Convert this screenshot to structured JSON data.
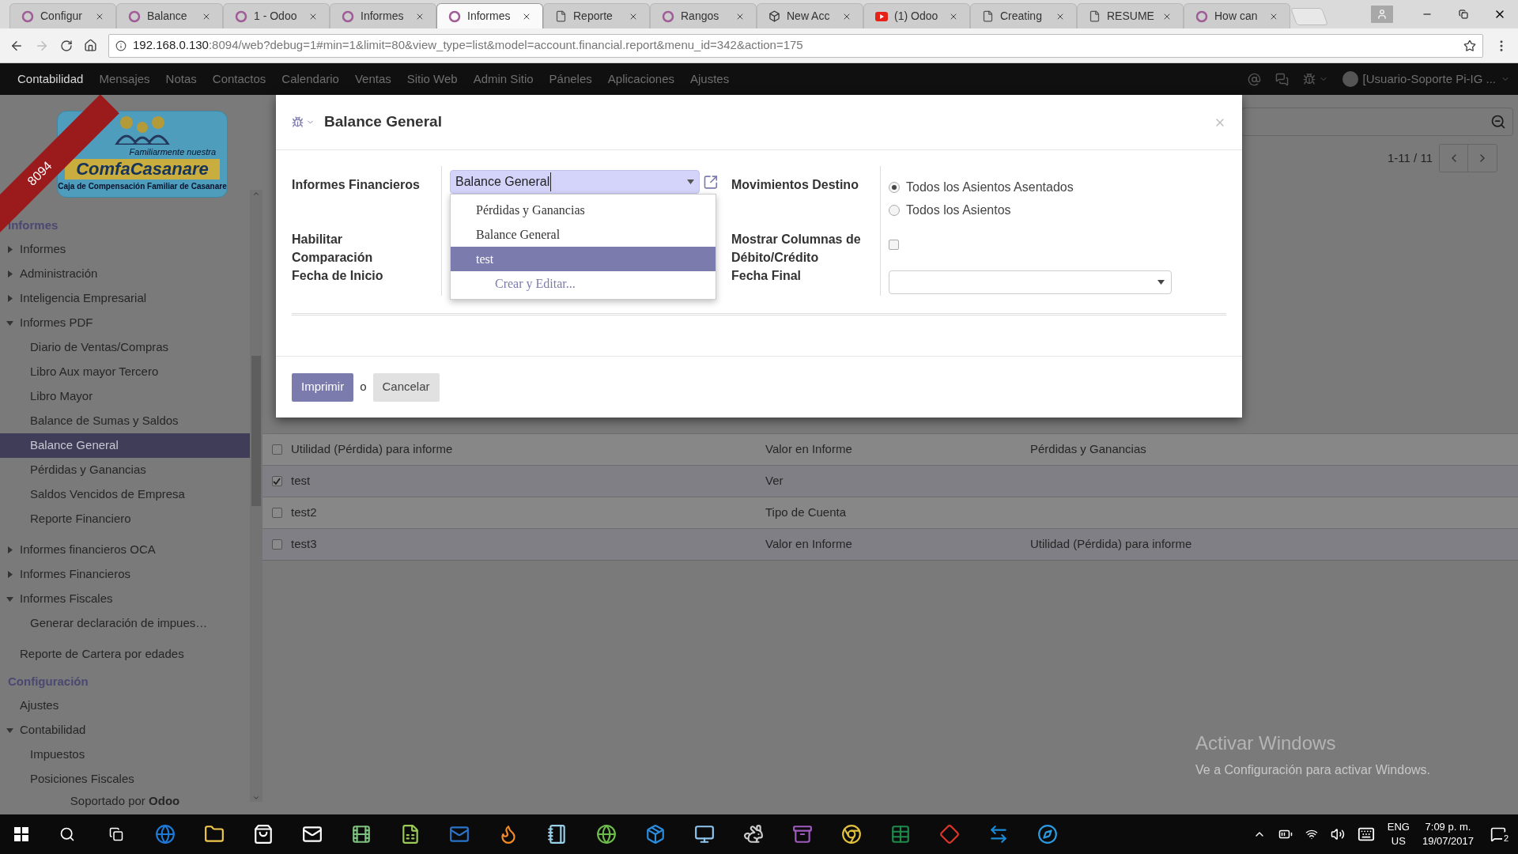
{
  "browser": {
    "tabs": [
      {
        "title": "Configur",
        "kind": "ring",
        "selected": false
      },
      {
        "title": "Balance",
        "kind": "ring",
        "selected": false
      },
      {
        "title": "1 - Odoo",
        "kind": "ring",
        "selected": false
      },
      {
        "title": "Informes",
        "kind": "ring",
        "selected": false
      },
      {
        "title": "Informes",
        "kind": "ring",
        "selected": true
      },
      {
        "title": "Reporte",
        "kind": "page",
        "selected": false
      },
      {
        "title": "Rangos",
        "kind": "ring",
        "selected": false
      },
      {
        "title": "New Acc",
        "kind": "cube",
        "selected": false
      },
      {
        "title": "(1) Odoo",
        "kind": "video",
        "selected": false
      },
      {
        "title": "Creating",
        "kind": "page",
        "selected": false
      },
      {
        "title": "RESUME",
        "kind": "page",
        "selected": false
      },
      {
        "title": "How can",
        "kind": "ring",
        "selected": false
      }
    ],
    "url_host": "192.168.0.130",
    "url_rest": ":8094/web?debug=1#min=1&limit=80&view_type=list&model=account.financial.report&menu_id=342&action=175"
  },
  "navbar": {
    "menu": [
      {
        "label": "Contabilidad",
        "selected": true
      },
      {
        "label": "Mensajes",
        "selected": false
      },
      {
        "label": "Notas",
        "selected": false
      },
      {
        "label": "Contactos",
        "selected": false
      },
      {
        "label": "Calendario",
        "selected": false
      },
      {
        "label": "Ventas",
        "selected": false
      },
      {
        "label": "Sitio Web",
        "selected": false
      },
      {
        "label": "Admin Sitio",
        "selected": false
      },
      {
        "label": "Páneles",
        "selected": false
      },
      {
        "label": "Aplicaciones",
        "selected": false
      },
      {
        "label": "Ajustes",
        "selected": false
      }
    ],
    "user": "[Usuario-Soporte Pi-IG ..."
  },
  "ribbon": "8094",
  "logo": {
    "tagline": "Familiarmente nuestra",
    "name": "ComfaCasanare",
    "subtitle": "Caja de Compensación Familiar de Casanare"
  },
  "sidebar": {
    "sections": [
      {
        "title": "Informes",
        "items": [
          {
            "label": "Informes",
            "expanded": false,
            "selected": false
          },
          {
            "label": "Administración",
            "expanded": false,
            "selected": false
          },
          {
            "label": "Inteligencia Empresarial",
            "expanded": false,
            "selected": false
          },
          {
            "label": "Informes PDF",
            "expanded": true,
            "selected": false,
            "children": [
              {
                "label": "Diario de Ventas/Compras",
                "selected": false
              },
              {
                "label": "Libro Aux mayor Tercero",
                "selected": false
              },
              {
                "label": "Libro Mayor",
                "selected": false
              },
              {
                "label": "Balance de Sumas y Saldos",
                "selected": false
              },
              {
                "label": "Balance General",
                "selected": true
              },
              {
                "label": "Pérdidas y Ganancias",
                "selected": false
              },
              {
                "label": "Saldos Vencidos de Empresa",
                "selected": false
              },
              {
                "label": "Reporte Financiero",
                "selected": false
              }
            ]
          },
          {
            "label": "Informes financieros OCA",
            "expanded": false,
            "selected": false
          },
          {
            "label": "Informes Financieros",
            "expanded": false,
            "selected": false
          },
          {
            "label": "Informes Fiscales",
            "expanded": true,
            "selected": false,
            "children": [
              {
                "label": "Generar declaración de impues…",
                "selected": false
              }
            ]
          },
          {
            "label": "Reporte de Cartera por edades",
            "selected": false
          }
        ]
      },
      {
        "title": "Configuración",
        "items": [
          {
            "label": "Ajustes",
            "selected": false
          },
          {
            "label": "Contabilidad",
            "expanded": true,
            "selected": false,
            "children": [
              {
                "label": "Impuestos",
                "selected": false
              },
              {
                "label": "Posiciones Fiscales",
                "selected": false
              }
            ]
          }
        ]
      }
    ],
    "footer": "Soportado por **Odoo**"
  },
  "list": {
    "pager": "1-11 / 11",
    "rows": [
      {
        "name": "Utilidad (Pérdida) para informe",
        "type": "Valor en Informe",
        "parent": "Pérdidas y Ganancias",
        "checked": false
      },
      {
        "name": "test",
        "type": "Ver",
        "checked": true
      },
      {
        "name": "test2",
        "type": "Tipo de Cuenta",
        "checked": false
      },
      {
        "name": "test3",
        "type": "Valor en Informe",
        "parent": "Utilidad (Pérdida) para informe",
        "checked": false
      }
    ]
  },
  "dialog": {
    "title": "Balance General",
    "report_label": "Informes Financieros",
    "report_value": "Balance General",
    "options": [
      {
        "label": "Pérdidas y Ganancias",
        "kind": "option",
        "selected": false
      },
      {
        "label": "Balance General",
        "kind": "option",
        "selected": false
      },
      {
        "label": "test",
        "kind": "option",
        "selected": true
      },
      {
        "label": "Crear y Editar...",
        "kind": "create",
        "selected": false
      }
    ],
    "left_labels": [
      "Habilitar Comparación",
      "Fecha de Inicio"
    ],
    "target_label": "Movimientos Destino",
    "target_options": [
      {
        "label": "Todos los Asientos Asentados",
        "selected": true
      },
      {
        "label": "Todos los Asientos",
        "selected": false
      }
    ],
    "debit_label": "Mostrar Columnas de Débito/Crédito",
    "debit_checked": false,
    "end_label": "Fecha Final",
    "print": "Imprimir",
    "or": "o",
    "cancel": "Cancelar"
  },
  "activation_notice": {
    "title": "Activar Windows",
    "text": "Ve a Configuración para activar Windows."
  },
  "taskbar": {
    "lang": "ENG",
    "region": "US",
    "time": "7:09 p. m.",
    "date": "19/07/2017",
    "notifications": "2"
  }
}
